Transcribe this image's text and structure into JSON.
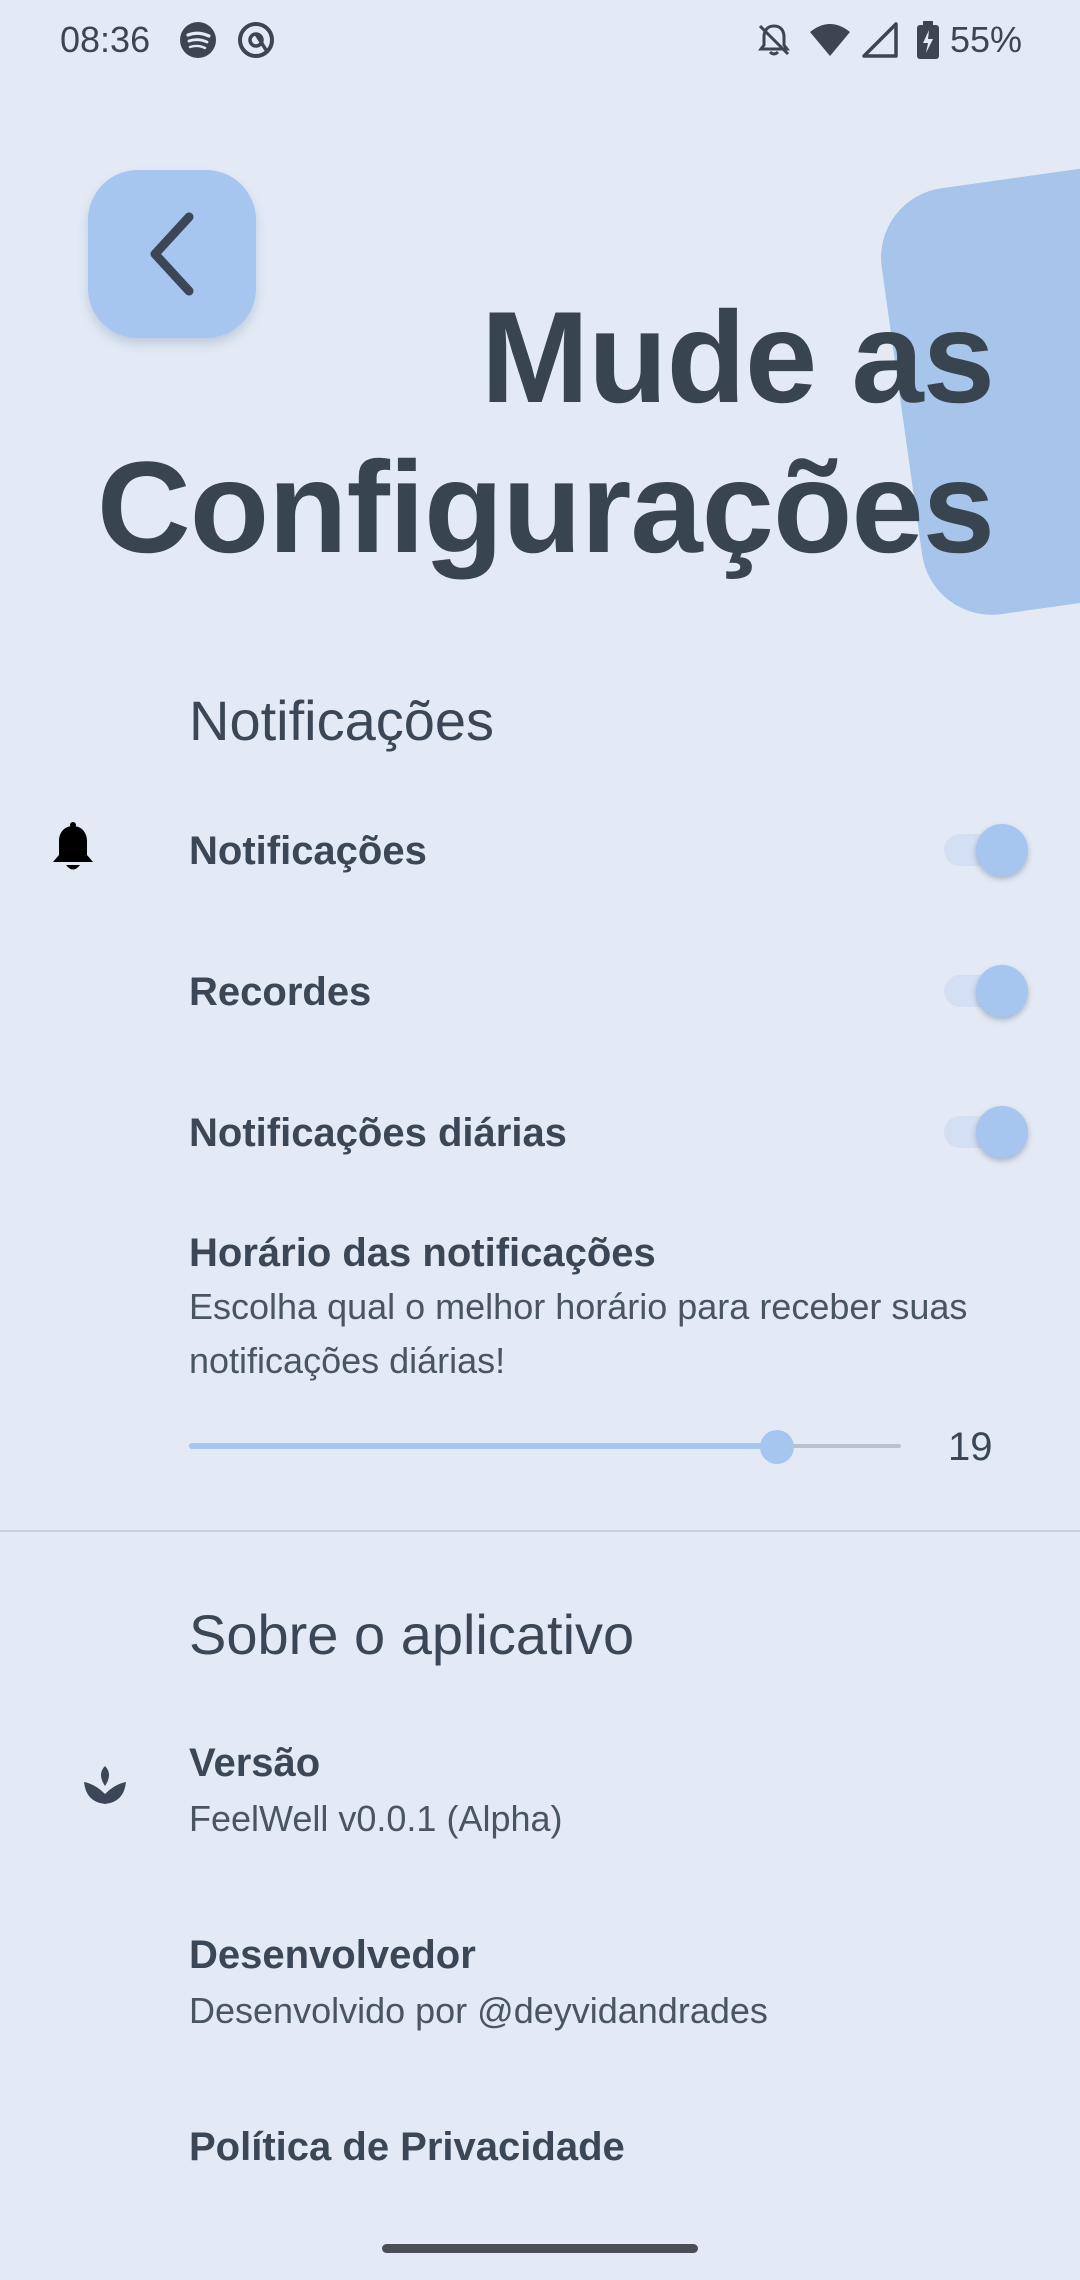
{
  "status_bar": {
    "time": "08:36",
    "battery": "55%",
    "icons": [
      "spotify-icon",
      "app-icon",
      "bell-off-icon",
      "wifi-icon",
      "signal-icon",
      "battery-icon"
    ]
  },
  "header": {
    "title_line1": "Mude as",
    "title_line2": "Configurações"
  },
  "notifications_section": {
    "title": "Notificações",
    "items": [
      {
        "label": "Notificações",
        "enabled": true
      },
      {
        "label": "Recordes",
        "enabled": true
      },
      {
        "label": "Notificações diárias",
        "enabled": true
      }
    ],
    "time_setting": {
      "label": "Horário das notificações",
      "description": "Escolha qual o melhor horário para receber suas notificações diárias!",
      "value": "19",
      "min": 0,
      "max": 23
    }
  },
  "about_section": {
    "title": "Sobre o aplicativo",
    "version_label": "Versão",
    "version_value": "FeelWell v0.0.1 (Alpha)",
    "developer_label": "Desenvolvedor",
    "developer_value": "Desenvolvido por @deyvidandrades",
    "privacy_label": "Política de Privacidade"
  },
  "colors": {
    "background": "#e3eaf5",
    "accent": "#a6c5ef",
    "text": "#3b4756"
  }
}
